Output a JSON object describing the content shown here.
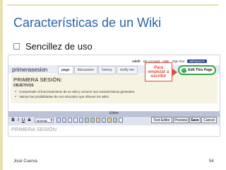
{
  "slide": {
    "title": "Características de un Wiki",
    "bullet": "Sencillez de uso",
    "footer_author": "José Cuerva",
    "footer_page": "54"
  },
  "wiki": {
    "account": {
      "user": "zdelfr",
      "links": [
        "My Account",
        "Help",
        "Sign Out"
      ],
      "badge": "wikispaces"
    },
    "page_name": "primerasesion",
    "tabs": [
      {
        "label": "page",
        "active": true
      },
      {
        "label": "discussion",
        "active": false
      },
      {
        "label": "history",
        "active": false
      },
      {
        "label": "notify me",
        "active": false
      }
    ],
    "content": {
      "heading": "PRIMERA SESIÓN:",
      "goals_label": "OBJETIVOS",
      "goals": [
        "Comprender el funcionamiento de un wiki y conocer sus características generales.",
        "Valorar las posibilidades de uso educativo que ofrecen los wikis."
      ]
    },
    "callout": [
      "Para",
      "empezar a",
      "escribir"
    ],
    "edit_button": "Edit This Page",
    "editor": {
      "title": "Editor",
      "bold": "B",
      "italic": "I",
      "underline": "U",
      "strike": "S",
      "format_select": "Normal",
      "text_editor": "Text Editor",
      "preview": "Preview",
      "save": "Save",
      "cancel": "Cancel",
      "content_preview": "PRIMERA SESIÓN"
    }
  }
}
